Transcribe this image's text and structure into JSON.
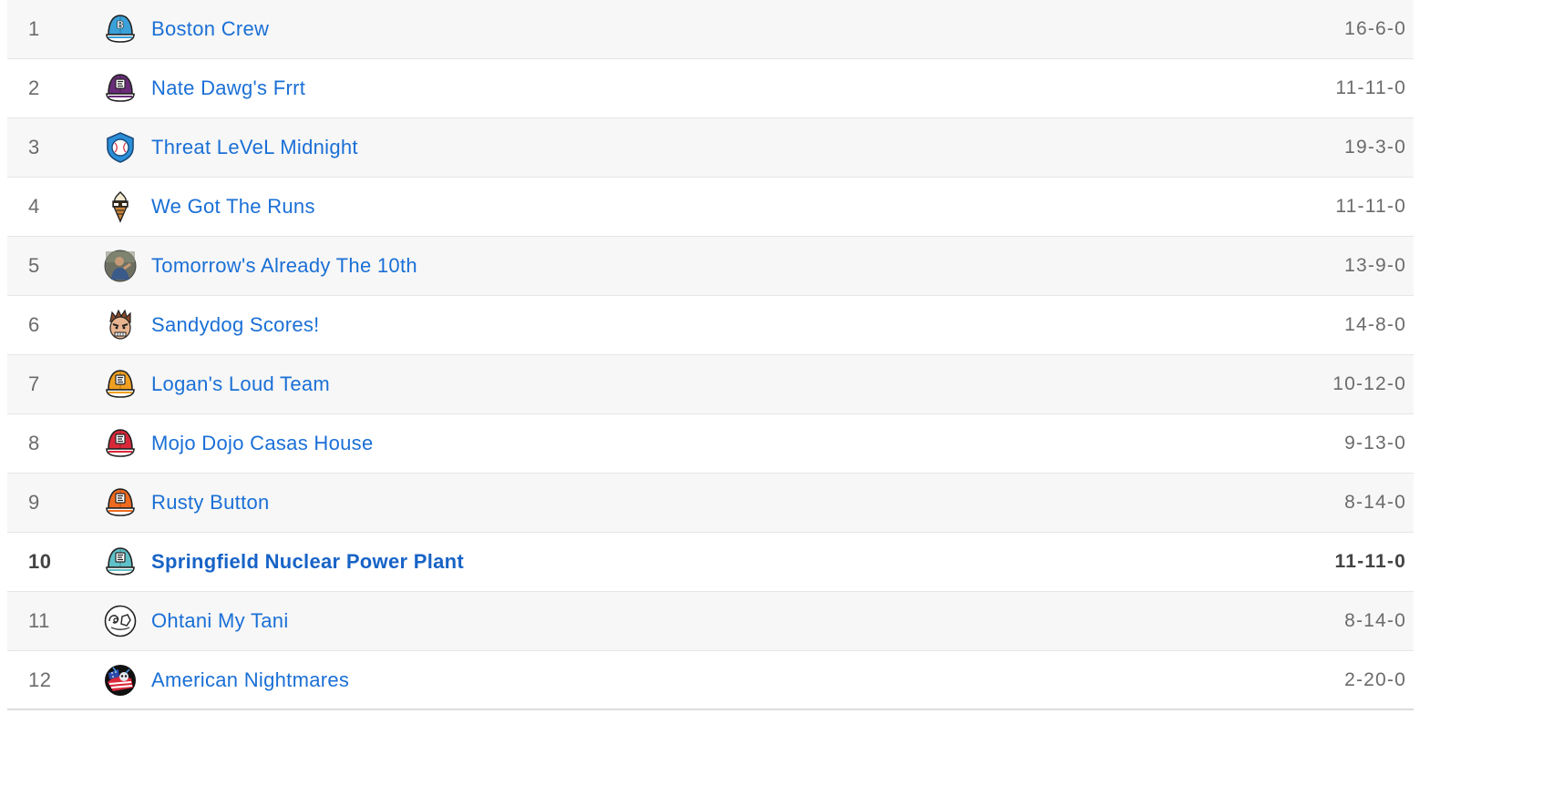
{
  "standings": [
    {
      "rank": "1",
      "team": "Boston Crew",
      "record": "16-6-0",
      "logo": "cap-b-icon",
      "color": "#3aa0d8"
    },
    {
      "rank": "2",
      "team": "Nate Dawg's Frrt",
      "record": "11-11-0",
      "logo": "cap-icon",
      "color": "#6a2c78"
    },
    {
      "rank": "3",
      "team": "Threat LeVeL Midnight",
      "record": "19-3-0",
      "logo": "baseball-shield-icon",
      "color": "#2a8fd8"
    },
    {
      "rank": "4",
      "team": "We Got The Runs",
      "record": "11-11-0",
      "logo": "ice-cream-icon",
      "color": "#3b2b1a"
    },
    {
      "rank": "5",
      "team": "Tomorrow's Already The 10th",
      "record": "13-9-0",
      "logo": "photo-avatar-icon",
      "color": "#7a7a6a"
    },
    {
      "rank": "6",
      "team": "Sandydog Scores!",
      "record": "14-8-0",
      "logo": "face-avatar-icon",
      "color": "#8a4a2a"
    },
    {
      "rank": "7",
      "team": "Logan's Loud Team",
      "record": "10-12-0",
      "logo": "cap-icon",
      "color": "#f0a020"
    },
    {
      "rank": "8",
      "team": "Mojo Dojo Casas House",
      "record": "9-13-0",
      "logo": "cap-icon",
      "color": "#d8283a"
    },
    {
      "rank": "9",
      "team": "Rusty Button",
      "record": "8-14-0",
      "logo": "cap-icon",
      "color": "#ee6a1e"
    },
    {
      "rank": "10",
      "team": "Springfield Nuclear Power Plant",
      "record": "11-11-0",
      "logo": "cap-icon",
      "color": "#5fc0c8",
      "highlight": true
    },
    {
      "rank": "11",
      "team": "Ohtani My Tani",
      "record": "8-14-0",
      "logo": "line-art-icon",
      "color": "#222222"
    },
    {
      "rank": "12",
      "team": "American Nightmares",
      "record": "2-20-0",
      "logo": "flag-skull-icon",
      "color": "#111111"
    }
  ]
}
